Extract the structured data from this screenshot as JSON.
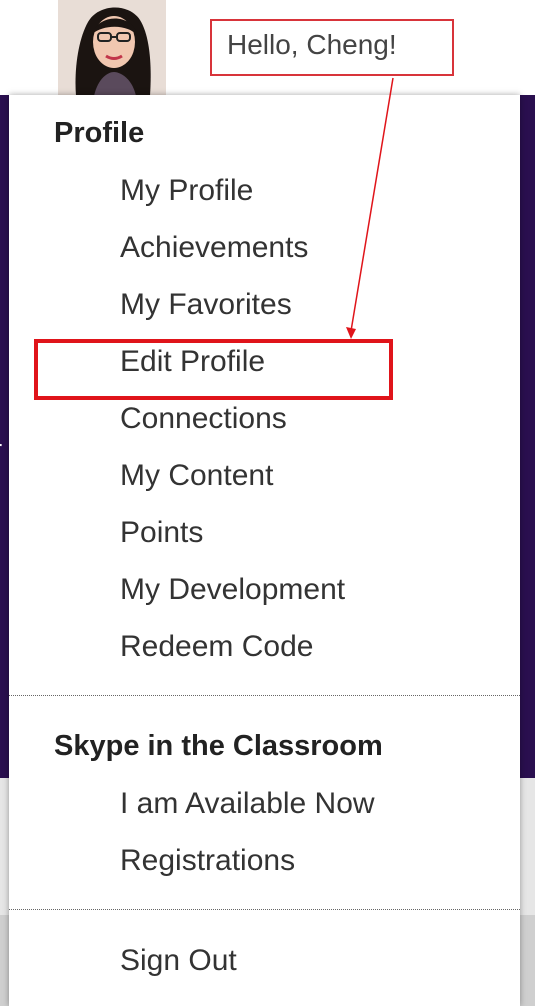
{
  "header": {
    "greeting": "Hello, Cheng!"
  },
  "menu": {
    "profile_section": {
      "title": "Profile",
      "items": [
        "My Profile",
        "Achievements",
        "My Favorites",
        "Edit Profile",
        "Connections",
        "My Content",
        "Points",
        "My Development",
        "Redeem Code"
      ]
    },
    "skype_section": {
      "title": "Skype in the Classroom",
      "items": [
        "I am Available Now",
        "Registrations"
      ]
    },
    "sign_out": "Sign Out"
  },
  "edge_text": "r",
  "colors": {
    "background_header": "#2a0f4f",
    "annotation_red": "#e0141a"
  }
}
